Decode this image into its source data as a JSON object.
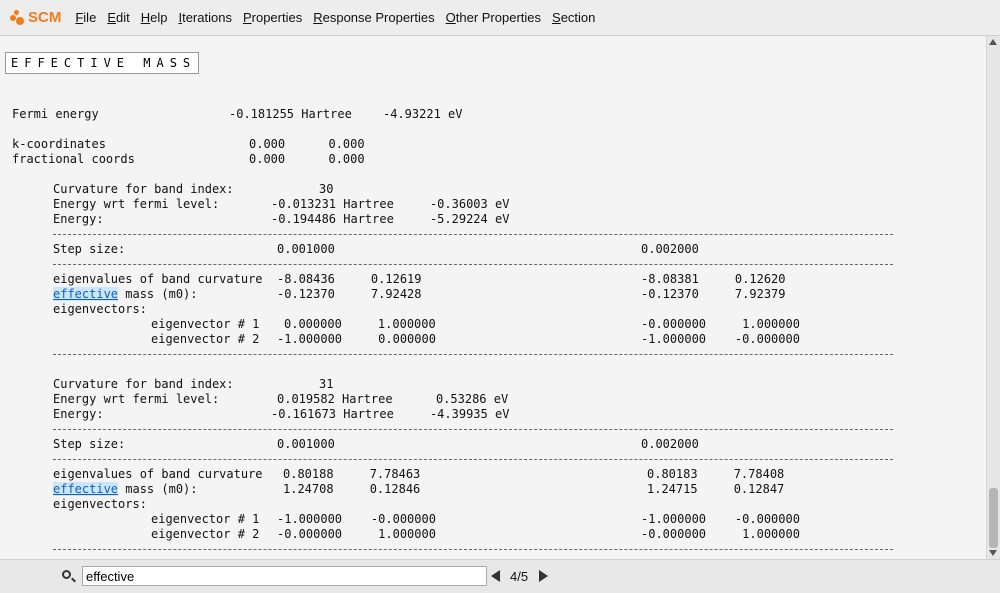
{
  "menubar": {
    "logo_text": "SCM",
    "items": [
      {
        "underlined": "F",
        "rest": "ile"
      },
      {
        "underlined": "E",
        "rest": "dit"
      },
      {
        "underlined": "H",
        "rest": "elp"
      },
      {
        "underlined": "I",
        "rest": "terations"
      },
      {
        "underlined": "P",
        "rest": "roperties"
      },
      {
        "underlined": "R",
        "rest": "esponse Properties"
      },
      {
        "underlined": "O",
        "rest": "ther Properties"
      },
      {
        "underlined": "S",
        "rest": "ection"
      }
    ]
  },
  "doc": {
    "title": "EFFECTIVE MASS",
    "fermi_label": "Fermi energy",
    "fermi_hartree": "-0.181255 Hartree",
    "fermi_ev": "-4.93221 eV",
    "kcoord_label": "k-coordinates",
    "kcoord_values": "0.000      0.000",
    "frac_label": "fractional coords",
    "frac_values": "0.000      0.000",
    "blocks": [
      {
        "band_label": "Curvature for band index:",
        "band_index": "30",
        "wrt_label": "Energy wrt fermi level:",
        "wrt_values": "-0.013231 Hartree     -0.36003 eV",
        "energy_label": "Energy:",
        "energy_values": "-0.194486 Hartree     -5.29224 eV",
        "step_label": "Step size:",
        "step_1": "0.001000",
        "step_2": "0.002000",
        "eig_label": "eigenvalues of band curvature",
        "eig_1": "-8.08436     0.12619",
        "eig_2": "-8.08381     0.12620",
        "eff_match": "effective",
        "eff_rest": " mass (m0):",
        "eff_1": "-0.12370     7.92428",
        "eff_2": "-0.12370     7.92379",
        "evec_label": "eigenvectors:",
        "ev1_label": "eigenvector # 1",
        "ev1_1": "0.000000     1.000000",
        "ev1_2": "-0.000000     1.000000",
        "ev2_label": "eigenvector # 2",
        "ev2_1": "-1.000000     0.000000",
        "ev2_2": "-1.000000    -0.000000"
      },
      {
        "band_label": "Curvature for band index:",
        "band_index": "31",
        "wrt_label": "Energy wrt fermi level:",
        "wrt_values": "0.019582 Hartree      0.53286 eV",
        "energy_label": "Energy:",
        "energy_values": "-0.161673 Hartree     -4.39935 eV",
        "step_label": "Step size:",
        "step_1": "0.001000",
        "step_2": "0.002000",
        "eig_label": "eigenvalues of band curvature",
        "eig_1": "0.80188     7.78463",
        "eig_2": "0.80183     7.78408",
        "eff_match": "effective",
        "eff_rest": " mass (m0):",
        "eff_1": "1.24708     0.12846",
        "eff_2": "1.24715     0.12847",
        "evec_label": "eigenvectors:",
        "ev1_label": "eigenvector # 1",
        "ev1_1": "-1.000000    -0.000000",
        "ev1_2": "-1.000000    -0.000000",
        "ev2_label": "eigenvector # 2",
        "ev2_1": "-0.000000     1.000000",
        "ev2_2": "-0.000000     1.000000"
      }
    ]
  },
  "findbar": {
    "query": "effective",
    "count": "4/5"
  }
}
